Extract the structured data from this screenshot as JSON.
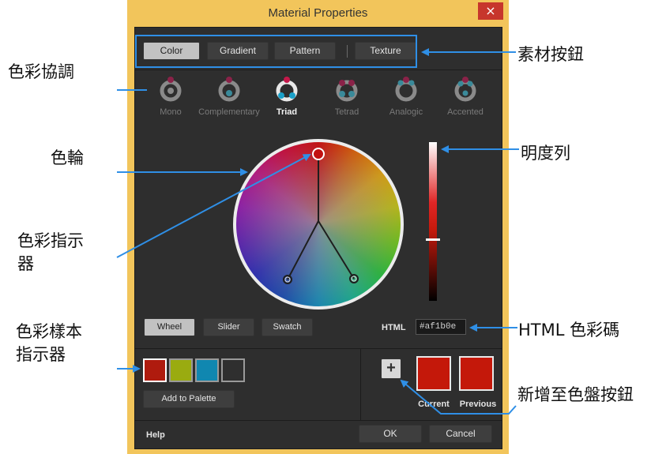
{
  "window": {
    "title": "Material Properties",
    "close_glyph": "×"
  },
  "tabs": [
    {
      "label": "Color",
      "selected": true
    },
    {
      "label": "Gradient",
      "selected": false
    },
    {
      "label": "Pattern",
      "selected": false
    },
    {
      "label": "Texture",
      "selected": false
    }
  ],
  "harmonies": [
    {
      "label": "Mono",
      "selected": false
    },
    {
      "label": "Complementary",
      "selected": false
    },
    {
      "label": "Triad",
      "selected": true
    },
    {
      "label": "Tetrad",
      "selected": false
    },
    {
      "label": "Analogic",
      "selected": false
    },
    {
      "label": "Accented",
      "selected": false
    }
  ],
  "modes": [
    {
      "label": "Wheel",
      "selected": true
    },
    {
      "label": "Slider",
      "selected": false
    },
    {
      "label": "Swatch",
      "selected": false
    }
  ],
  "html": {
    "label": "HTML",
    "value": "#af1b0e"
  },
  "palette": {
    "swatches": [
      "#af1b0e",
      "#9aab10",
      "#1087b0",
      "#2f2f2f"
    ],
    "add_label": "Add to Palette",
    "plus_glyph": "+"
  },
  "preview": {
    "current_label": "Current",
    "previous_label": "Previous",
    "current_color": "#c4180a",
    "previous_color": "#c4180a"
  },
  "footer": {
    "help": "Help",
    "ok": "OK",
    "cancel": "Cancel"
  },
  "colors": {
    "accent_arrow": "#2f8fe6",
    "dialog_bg": "#2e2e2e",
    "frame": "#f2c55b"
  },
  "annotations": {
    "material_buttons": "素材按鈕",
    "color_harmony": "色彩協調",
    "color_wheel": "色輪",
    "brightness_bar": "明度列",
    "color_indicator_1": "色彩指示",
    "color_indicator_2": "器",
    "html_code": "HTML 色彩碼",
    "swatch_indicator_1": "色彩樣本",
    "swatch_indicator_2": "指示器",
    "add_to_palette_button": "新增至色盤按鈕"
  }
}
